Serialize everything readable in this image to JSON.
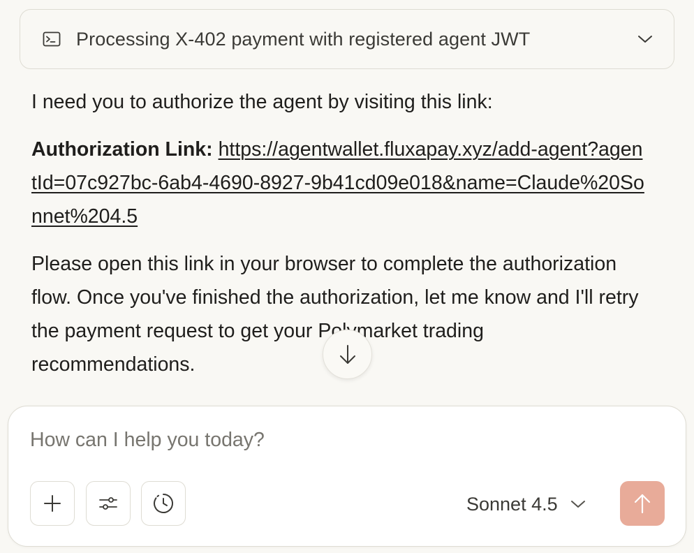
{
  "tool_call": {
    "title": "Processing X-402 payment with registered agent JWT",
    "icon": "terminal-icon",
    "expand_icon": "chevron-down-icon"
  },
  "message": {
    "intro": "I need you to authorize the agent by visiting this link:",
    "link_label": "Authorization Link:",
    "link_url": "https://agentwallet.fluxapay.xyz/add-agent?agentId=07c927bc-6ab4-4690-8927-9b41cd09e018&name=Claude%20Sonnet%204.5",
    "closing": "Please open this link in your browser to complete the authorization flow. Once you've finished the authorization, let me know and I'll retry the payment request to get your Polymarket trading recommendations."
  },
  "scroll_button": {
    "icon": "arrow-down-icon"
  },
  "composer": {
    "placeholder": "How can I help you today?",
    "value": "",
    "buttons": [
      {
        "icon": "plus-icon"
      },
      {
        "icon": "sliders-icon"
      },
      {
        "icon": "history-icon"
      }
    ],
    "model": "Sonnet 4.5",
    "send_icon": "arrow-up-icon",
    "send_color": "#e8ab99"
  }
}
